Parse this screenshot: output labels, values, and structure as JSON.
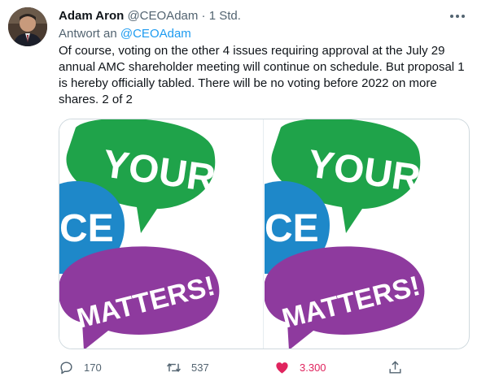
{
  "author": {
    "name": "Adam Aron",
    "handle": "@CEOAdam",
    "separator": "·",
    "time": "1 Std."
  },
  "reply": {
    "prefix": "Antwort an ",
    "to": "@CEOAdam"
  },
  "tweet_text": "Of course, voting on the other 4 issues requiring approval at the July 29 annual AMC shareholder meeting will continue on schedule. But proposal 1 is hereby officially tabled. There will be no voting before 2022 on more shares. 2 of 2",
  "media": {
    "image_text_top": "YOUR",
    "image_text_left": "CE",
    "image_text_bottom": "MATTERS!",
    "colors": {
      "green": "#1fa34a",
      "blue": "#1e88c9",
      "purple": "#8e3a9e"
    }
  },
  "actions": {
    "replies": "170",
    "retweets": "537",
    "likes": "3.300"
  },
  "colors": {
    "accent": "#1d9bf0",
    "like": "#e0245e",
    "muted": "#536471"
  }
}
